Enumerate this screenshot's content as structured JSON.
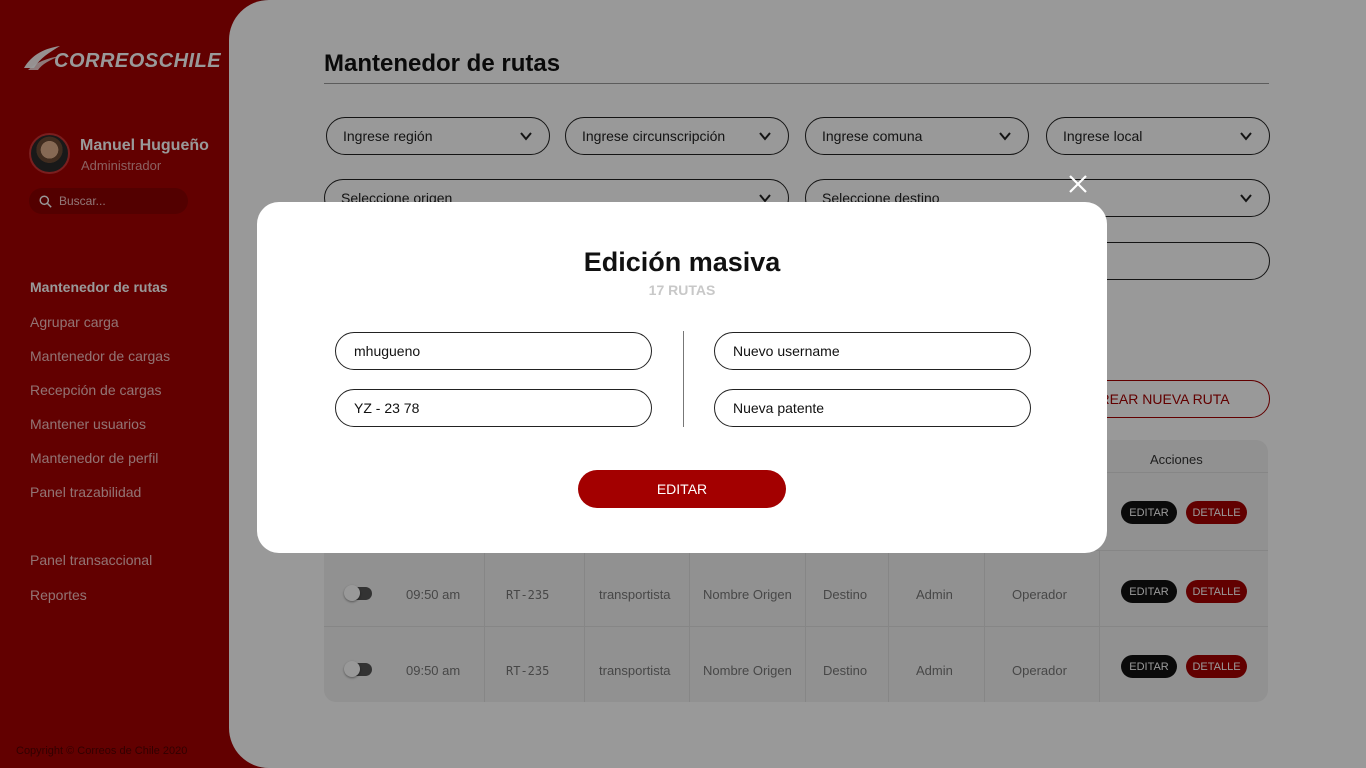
{
  "brand": {
    "logo_text": "CORREOSCHILE",
    "accent": "#a30000"
  },
  "user": {
    "name": "Manuel Hugueño",
    "role": "Administrador"
  },
  "search": {
    "placeholder": "Buscar..."
  },
  "nav": {
    "items": [
      "Mantenedor de rutas",
      "Agrupar carga",
      "Mantenedor de cargas",
      "Recepción de cargas",
      "Mantener usuarios",
      "Mantenedor de perfil",
      "Panel trazabilidad",
      "Panel transaccional",
      "Reportes"
    ],
    "active": "Mantenedor de rutas"
  },
  "copyright": "Copyright © Correos de Chile 2020",
  "page": {
    "title": "Mantenedor de rutas"
  },
  "filters": {
    "region": "Ingrese región",
    "circunscripcion": "Ingrese circunscripción",
    "comuna": "Ingrese comuna",
    "local": "Ingrese local",
    "origen": "Seleccione origen",
    "destino": "Seleccione destino"
  },
  "create_button": "CREAR NUEVA RUTA",
  "table": {
    "actions_header": "Acciones",
    "edit_label": "EDITAR",
    "detail_label": "DETALLE",
    "rows": [
      {
        "time": "09:50 am",
        "code": "RT-235",
        "type": "transportista",
        "origin": "Nombre Origen",
        "dest": "Destino",
        "admin": "Admin",
        "role": "Operador"
      },
      {
        "time": "09:50 am",
        "code": "RT-235",
        "type": "transportista",
        "origin": "Nombre Origen",
        "dest": "Destino",
        "admin": "Admin",
        "role": "Operador"
      }
    ]
  },
  "modal": {
    "title": "Edición masiva",
    "subtitle": "17 RUTAS",
    "current_username": "mhugueno",
    "current_patente": "YZ - 23 78",
    "new_username_placeholder": "Nuevo username",
    "new_patente_placeholder": "Nueva patente",
    "submit_label": "EDITAR"
  }
}
